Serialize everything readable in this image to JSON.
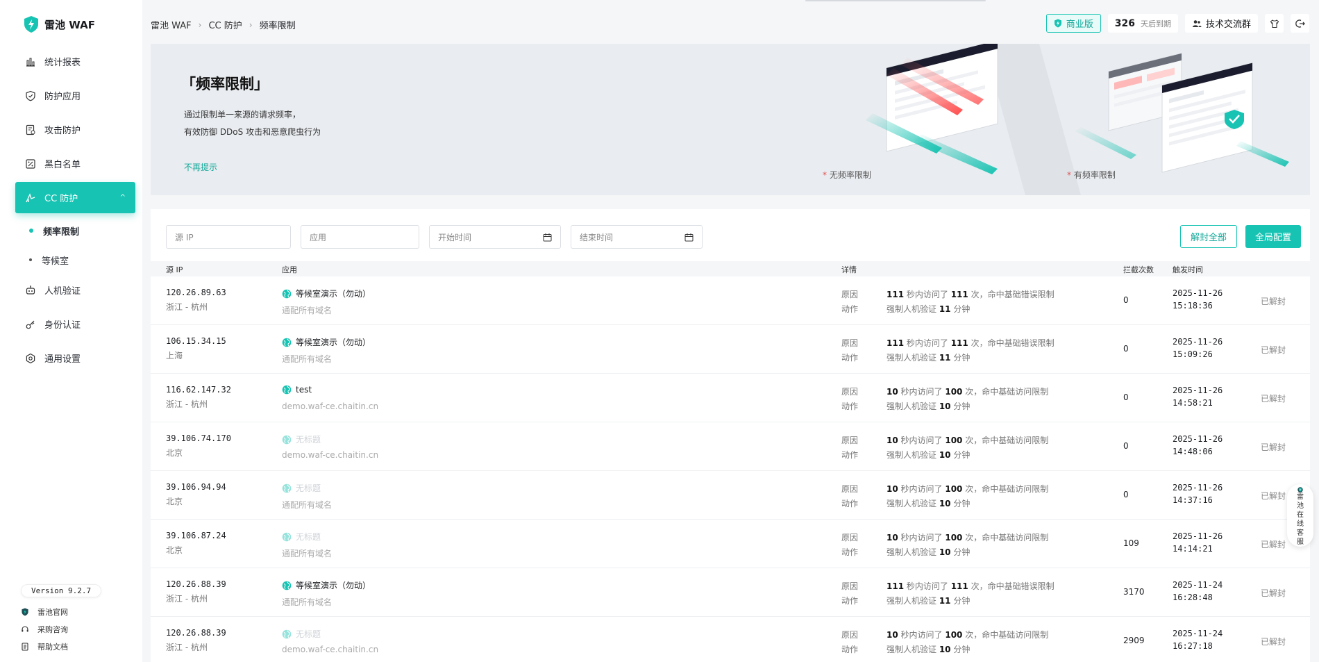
{
  "brand": {
    "name": "雷池 WAF"
  },
  "sidebar": {
    "items": [
      {
        "label": "统计报表",
        "icon": "bar-chart-icon"
      },
      {
        "label": "防护应用",
        "icon": "shield-icon"
      },
      {
        "label": "攻击防护",
        "icon": "document-shield-icon"
      },
      {
        "label": "黑白名单",
        "icon": "list-icon"
      },
      {
        "label": "CC 防护",
        "icon": "cc-icon",
        "active": true
      }
    ],
    "sub_items": [
      {
        "label": "频率限制",
        "active": true
      },
      {
        "label": "等候室"
      }
    ],
    "items_after": [
      {
        "label": "人机验证",
        "icon": "robot-icon"
      },
      {
        "label": "身份认证",
        "icon": "key-icon"
      },
      {
        "label": "通用设置",
        "icon": "settings-icon"
      }
    ],
    "version": "Version 9.2.7",
    "footer_links": [
      {
        "label": "雷池官网",
        "icon": "leichi-logo-icon"
      },
      {
        "label": "采购咨询",
        "icon": "headset-icon"
      },
      {
        "label": "帮助文档",
        "icon": "doc-icon"
      }
    ]
  },
  "header": {
    "breadcrumb": [
      "雷池 WAF",
      "CC 防护",
      "频率限制"
    ],
    "edition": "商业版",
    "days": "326",
    "days_label": "天后到期",
    "community": "技术交流群"
  },
  "banner": {
    "title": "「频率限制」",
    "desc_line1": "通过限制单一来源的请求频率，",
    "desc_line2": "有效防御 DDoS 攻击和恶意爬虫行为",
    "dismiss": "不再提示",
    "caption_left": "无频率限制",
    "caption_right": "有频率限制"
  },
  "filters": {
    "source_ip": "源 IP",
    "app": "应用",
    "start_time": "开始时间",
    "end_time": "结束时间",
    "unblock_all": "解封全部",
    "global_config": "全局配置"
  },
  "table": {
    "headers": {
      "ip": "源 IP",
      "app": "应用",
      "detail": "详情",
      "count": "拦截次数",
      "time": "触发时间"
    },
    "reason_label": "原因",
    "action_label": "动作",
    "rows": [
      {
        "ip": "120.26.89.63",
        "loc": "浙江 - 杭州",
        "app": "等候室演示（勿动）",
        "app_dim": false,
        "domain": "通配所有域名",
        "r_sec": "111",
        "r_t1": " 秒内访问了 ",
        "r_cnt": "111",
        "r_t2": " 次，命中基础错误限制",
        "a_t1": "强制人机验证 ",
        "a_min": "11",
        "a_t2": " 分钟",
        "count": "0",
        "date": "2025-11-26",
        "time": "15:18:36",
        "status": "已解封"
      },
      {
        "ip": "106.15.34.15",
        "loc": "上海",
        "app": "等候室演示（勿动）",
        "app_dim": false,
        "domain": "通配所有域名",
        "r_sec": "111",
        "r_t1": " 秒内访问了 ",
        "r_cnt": "111",
        "r_t2": " 次，命中基础错误限制",
        "a_t1": "强制人机验证 ",
        "a_min": "11",
        "a_t2": " 分钟",
        "count": "0",
        "date": "2025-11-26",
        "time": "15:09:26",
        "status": "已解封"
      },
      {
        "ip": "116.62.147.32",
        "loc": "浙江 - 杭州",
        "app": "test",
        "app_dim": false,
        "domain": "demo.waf-ce.chaitin.cn",
        "r_sec": "10",
        "r_t1": " 秒内访问了 ",
        "r_cnt": "100",
        "r_t2": " 次，命中基础访问限制",
        "a_t1": "强制人机验证 ",
        "a_min": "10",
        "a_t2": " 分钟",
        "count": "0",
        "date": "2025-11-26",
        "time": "14:58:21",
        "status": "已解封"
      },
      {
        "ip": "39.106.74.170",
        "loc": "北京",
        "app": "无标题",
        "app_dim": true,
        "domain": "demo.waf-ce.chaitin.cn",
        "r_sec": "10",
        "r_t1": " 秒内访问了 ",
        "r_cnt": "100",
        "r_t2": " 次，命中基础访问限制",
        "a_t1": "强制人机验证 ",
        "a_min": "10",
        "a_t2": " 分钟",
        "count": "0",
        "date": "2025-11-26",
        "time": "14:48:06",
        "status": "已解封"
      },
      {
        "ip": "39.106.94.94",
        "loc": "北京",
        "app": "无标题",
        "app_dim": true,
        "domain": "通配所有域名",
        "r_sec": "10",
        "r_t1": " 秒内访问了 ",
        "r_cnt": "100",
        "r_t2": " 次，命中基础访问限制",
        "a_t1": "强制人机验证 ",
        "a_min": "10",
        "a_t2": " 分钟",
        "count": "0",
        "date": "2025-11-26",
        "time": "14:37:16",
        "status": "已解封"
      },
      {
        "ip": "39.106.87.24",
        "loc": "北京",
        "app": "无标题",
        "app_dim": true,
        "domain": "通配所有域名",
        "r_sec": "10",
        "r_t1": " 秒内访问了 ",
        "r_cnt": "100",
        "r_t2": " 次，命中基础访问限制",
        "a_t1": "强制人机验证 ",
        "a_min": "10",
        "a_t2": " 分钟",
        "count": "109",
        "date": "2025-11-26",
        "time": "14:14:21",
        "status": "已解封"
      },
      {
        "ip": "120.26.88.39",
        "loc": "浙江 - 杭州",
        "app": "等候室演示（勿动）",
        "app_dim": false,
        "domain": "通配所有域名",
        "r_sec": "111",
        "r_t1": " 秒内访问了 ",
        "r_cnt": "111",
        "r_t2": " 次，命中基础错误限制",
        "a_t1": "强制人机验证 ",
        "a_min": "11",
        "a_t2": " 分钟",
        "count": "3170",
        "date": "2025-11-24",
        "time": "16:28:48",
        "status": "已解封"
      },
      {
        "ip": "120.26.88.39",
        "loc": "浙江 - 杭州",
        "app": "无标题",
        "app_dim": true,
        "domain": "demo.waf-ce.chaitin.cn",
        "r_sec": "10",
        "r_t1": " 秒内访问了 ",
        "r_cnt": "100",
        "r_t2": " 次，命中基础访问限制",
        "a_t1": "强制人机验证 ",
        "a_min": "10",
        "a_t2": " 分钟",
        "count": "2909",
        "date": "2025-11-24",
        "time": "16:27:18",
        "status": "已解封"
      }
    ]
  },
  "float_service": {
    "label": "雷池在线客服"
  },
  "colors": {
    "accent": "#17c3b2",
    "accent_dark": "#12a99a",
    "bg": "#f5f6f8"
  }
}
